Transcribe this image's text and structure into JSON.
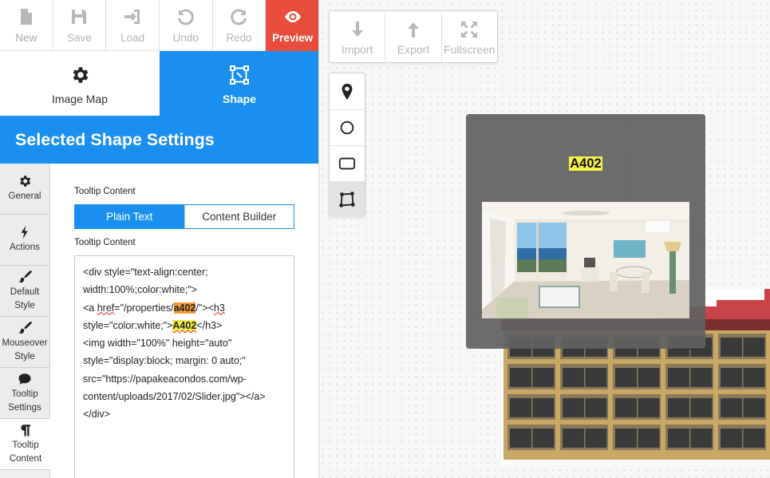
{
  "toolbar": {
    "new_label": "New",
    "save_label": "Save",
    "load_label": "Load",
    "undo_label": "Undo",
    "redo_label": "Redo",
    "preview_label": "Preview"
  },
  "modes": {
    "image_map_label": "Image Map",
    "shape_label": "Shape"
  },
  "settings_title": "Selected Shape Settings",
  "side_tabs": [
    {
      "label": "General"
    },
    {
      "label": "Actions"
    },
    {
      "label": "Default Style"
    },
    {
      "label": "Mouseover Style"
    },
    {
      "label": "Tooltip Settings"
    },
    {
      "label": "Tooltip Content"
    }
  ],
  "tooltip_content": {
    "label_1": "Tooltip Content",
    "plain_text_label": "Plain Text",
    "content_builder_label": "Content Builder",
    "label_2": "Tooltip Content",
    "code": {
      "l1": "<div style=\"text-align:center; width:100%;color:white;\">",
      "l2a": "<a ",
      "l2b": "href",
      "l2c": "=\"/properties/",
      "l2d": "a402",
      "l2e": "/\"><",
      "l2f": "h3",
      "l3a": "style=\"color:white;\">",
      "l3b": "A402",
      "l3c": "</h3>",
      "l4": "<img width=\"100%\" height=\"auto\" style=\"display:block; margin: 0 auto;\" src=\"https://papakeacondos.com/wp-content/uploads/2017/02/Slider.jpg\"></a>",
      "l5": "</div>"
    }
  },
  "canvas": {
    "import_label": "Import",
    "export_label": "Export",
    "fullscreen_label": "Fullscreen",
    "tooltip_title": "A402"
  },
  "colors": {
    "accent": "#1a8ff0",
    "preview": "#e74c3c",
    "highlight_yellow": "#f4f04a",
    "highlight_orange": "#f29a3a"
  },
  "icons": {
    "new": "file-icon",
    "save": "floppy-icon",
    "load": "sign-in-icon",
    "undo": "undo-icon",
    "redo": "redo-icon",
    "preview": "eye-icon",
    "image_map": "gear-icon",
    "shape": "vector-shape-icon",
    "import": "arrow-down-icon",
    "export": "arrow-up-icon",
    "fullscreen": "expand-icon",
    "tools": [
      "map-marker-icon",
      "circle-icon",
      "rectangle-icon",
      "polygon-icon"
    ]
  }
}
